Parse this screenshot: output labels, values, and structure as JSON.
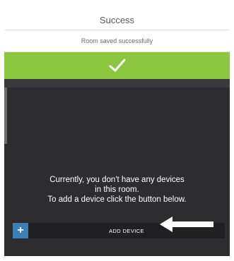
{
  "dialog": {
    "title": "Success",
    "message": "Room saved successfully",
    "confirm_icon": "checkmark-icon",
    "confirm_color": "#8cc63e"
  },
  "tabs": [
    {
      "label": ""
    },
    {
      "label": ""
    },
    {
      "label": ""
    }
  ],
  "empty_state": {
    "line1": "Currently, you don't have any devices",
    "line2": "in this room.",
    "line3": "To add a device click the button below."
  },
  "add_device": {
    "plus_label": "+",
    "label": "ADD DEVICE",
    "plus_color": "#3e7fb5"
  },
  "annotation": {
    "icon": "arrow-left-icon"
  }
}
